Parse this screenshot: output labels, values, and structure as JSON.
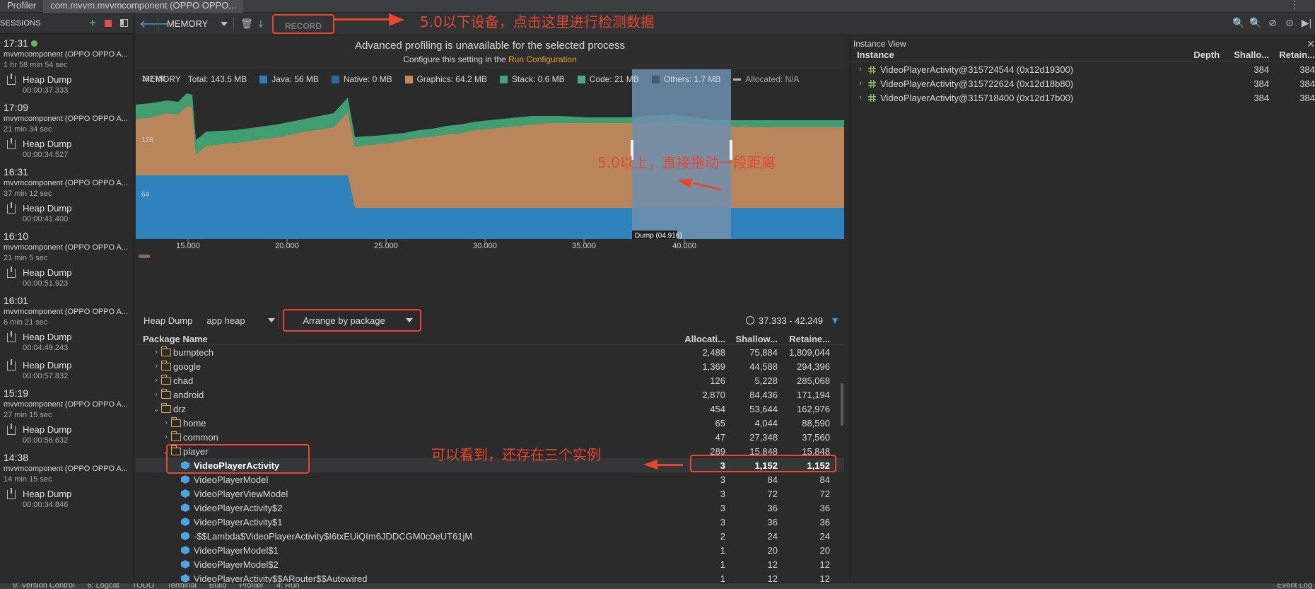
{
  "titlebar": {
    "tabs": [
      "Profiler",
      "com.mvvm.mvvmcomponent (OPPO OPPO..."
    ]
  },
  "sessions": {
    "header": "SESSIONS",
    "items": [
      {
        "time": "17:31",
        "live": true,
        "name": "mvvmcomponent (OPPO OPPO A...",
        "duration": "1 hr 58 min 54 sec",
        "dumps": [
          {
            "label": "Heap Dump",
            "time": "00:00:37.333"
          }
        ]
      },
      {
        "time": "17:09",
        "live": false,
        "name": "mvvmcomponent (OPPO OPPO A...",
        "duration": "21 min 34 sec",
        "dumps": [
          {
            "label": "Heap Dump",
            "time": "00:00:34.527"
          }
        ]
      },
      {
        "time": "16:31",
        "live": false,
        "name": "mvvmcomponent (OPPO OPPO A...",
        "duration": "37 min 12 sec",
        "dumps": [
          {
            "label": "Heap Dump",
            "time": "00:00:41.400"
          }
        ]
      },
      {
        "time": "16:10",
        "live": false,
        "name": "mvvmcomponent (OPPO OPPO A...",
        "duration": "21 min 5 sec",
        "dumps": [
          {
            "label": "Heap Dump",
            "time": "00:00:51.923"
          }
        ]
      },
      {
        "time": "16:01",
        "live": false,
        "name": "mvvmcomponent (OPPO OPPO A...",
        "duration": "6 min 21 sec",
        "dumps": [
          {
            "label": "Heap Dump",
            "time": "00:04:49.243"
          },
          {
            "label": "Heap Dump",
            "time": "00:00:57.832"
          }
        ]
      },
      {
        "time": "15:19",
        "live": false,
        "name": "mvvmcomponent (OPPO OPPO A...",
        "duration": "27 min 15 sec",
        "dumps": [
          {
            "label": "Heap Dump",
            "time": "00:00:56.632"
          }
        ]
      },
      {
        "time": "14:38",
        "live": false,
        "name": "mvvmcomponent (OPPO OPPO A...",
        "duration": "14 min 15 sec",
        "dumps": [
          {
            "label": "Heap Dump",
            "time": "00:00:34.846"
          }
        ]
      }
    ]
  },
  "toolbar": {
    "profiler_select": "MEMORY",
    "record_label": "RECORD"
  },
  "annotations": {
    "record_note": "5.0以下设备，点击这里进行检测数据",
    "drag_note": "5.0以上，直接拖动一段距离",
    "instances_note": "可以看到，还存在三个实例"
  },
  "advanced": {
    "title": "Advanced profiling is unavailable for the selected process",
    "subtitle_prefix": "Configure this setting in the ",
    "subtitle_link": "Run Configuration"
  },
  "legend": {
    "label": "MEMORY",
    "total": "Total: 143.5 MB",
    "items": [
      {
        "text": "Java: 56 MB",
        "color": "#2d7fb8"
      },
      {
        "text": "Native: 0 MB",
        "color": "#2a6aa0"
      },
      {
        "text": "Graphics: 64.2 MB",
        "color": "#c08a5d"
      },
      {
        "text": "Stack: 0.6 MB",
        "color": "#3fa67a"
      },
      {
        "text": "Code: 21 MB",
        "color": "#45b07c"
      },
      {
        "text": "Others: 1.7 MB",
        "color": "#4b5a66"
      },
      {
        "text": "Allocated: N/A",
        "color": "#9fb5c8"
      }
    ]
  },
  "chart_data": {
    "type": "area",
    "ylabel_ticks": [
      "192 MB",
      "128",
      "64"
    ],
    "x_ticks": [
      "15.000",
      "20.000",
      "25.000",
      "30.000",
      "35.000",
      "40.000"
    ],
    "selection_label": "Dump (04.916)",
    "series": [
      {
        "name": "Java"
      },
      {
        "name": "Graphics"
      },
      {
        "name": "Code"
      }
    ],
    "colors": {
      "java": "#2e83bd",
      "graphics": "#b9865c",
      "code": "#3f9f72",
      "selection": "#6d8fae"
    }
  },
  "heapbar": {
    "label": "Heap Dump",
    "heap_select": "app heap",
    "arrange_select": "Arrange by package",
    "range": "37.333 - 42.249"
  },
  "package_table": {
    "headers": {
      "name": "Package Name",
      "alloc": "Allocati...",
      "shallow": "Shallow...",
      "retained": "Retaine..."
    },
    "rows": [
      {
        "name": "bumptech",
        "kind": "folder",
        "indent": 1,
        "open": false,
        "alloc": "2,488",
        "shallow": "75,884",
        "retained": "1,809,044"
      },
      {
        "name": "google",
        "kind": "folder",
        "indent": 1,
        "open": false,
        "alloc": "1,369",
        "shallow": "44,588",
        "retained": "294,396"
      },
      {
        "name": "chad",
        "kind": "folder",
        "indent": 1,
        "open": false,
        "alloc": "126",
        "shallow": "5,228",
        "retained": "285,068"
      },
      {
        "name": "android",
        "kind": "folder",
        "indent": 1,
        "open": false,
        "alloc": "2,870",
        "shallow": "84,436",
        "retained": "171,194"
      },
      {
        "name": "drz",
        "kind": "folder",
        "indent": 1,
        "open": true,
        "alloc": "454",
        "shallow": "53,644",
        "retained": "162,976"
      },
      {
        "name": "home",
        "kind": "folder",
        "indent": 2,
        "open": false,
        "alloc": "65",
        "shallow": "4,044",
        "retained": "88,590"
      },
      {
        "name": "common",
        "kind": "folder",
        "indent": 2,
        "open": false,
        "alloc": "47",
        "shallow": "27,348",
        "retained": "37,560"
      },
      {
        "name": "player",
        "kind": "folder",
        "indent": 2,
        "open": true,
        "alloc": "289",
        "shallow": "15,848",
        "retained": "15,848"
      },
      {
        "name": "VideoPlayerActivity",
        "kind": "class",
        "indent": 3,
        "selected": true,
        "alloc": "3",
        "shallow": "1,152",
        "retained": "1,152"
      },
      {
        "name": "VideoPlayerModel",
        "kind": "class",
        "indent": 3,
        "alloc": "3",
        "shallow": "84",
        "retained": "84"
      },
      {
        "name": "VideoPlayerViewModel",
        "kind": "class",
        "indent": 3,
        "alloc": "3",
        "shallow": "72",
        "retained": "72"
      },
      {
        "name": "VideoPlayerActivity$2",
        "kind": "class",
        "indent": 3,
        "alloc": "3",
        "shallow": "36",
        "retained": "36"
      },
      {
        "name": "VideoPlayerActivity$1",
        "kind": "class",
        "indent": 3,
        "alloc": "3",
        "shallow": "36",
        "retained": "36"
      },
      {
        "name": "-$$Lambda$VideoPlayerActivity$I6txEUiQIm6JDDCGM0c0eUT61jM",
        "kind": "class",
        "indent": 3,
        "alloc": "2",
        "shallow": "24",
        "retained": "24"
      },
      {
        "name": "VideoPlayerModel$1",
        "kind": "class",
        "indent": 3,
        "alloc": "1",
        "shallow": "20",
        "retained": "20"
      },
      {
        "name": "VideoPlayerModel$2",
        "kind": "class",
        "indent": 3,
        "alloc": "1",
        "shallow": "12",
        "retained": "12"
      },
      {
        "name": "VideoPlayerActivity$$ARouter$$Autowired",
        "kind": "class",
        "indent": 3,
        "alloc": "1",
        "shallow": "12",
        "retained": "12"
      }
    ]
  },
  "instance_view": {
    "title": "Instance View",
    "headers": {
      "instance": "Instance",
      "depth": "Depth",
      "shallow": "Shallo...",
      "retained": "Retain..."
    },
    "rows": [
      {
        "name": "VideoPlayerActivity@315724544 (0x12d19300)",
        "depth": "",
        "shallow": "384",
        "retained": "384"
      },
      {
        "name": "VideoPlayerActivity@315722624 (0x12d18b80)",
        "depth": "",
        "shallow": "384",
        "retained": "384"
      },
      {
        "name": "VideoPlayerActivity@315718400 (0x12d17b00)",
        "depth": "",
        "shallow": "384",
        "retained": "384"
      }
    ]
  },
  "statusbar": {
    "items": [
      "9: Version Control",
      "6: Logcat",
      "TODO",
      "Terminal",
      "Build",
      "Profiler",
      "4: Run",
      "Event Log"
    ]
  }
}
